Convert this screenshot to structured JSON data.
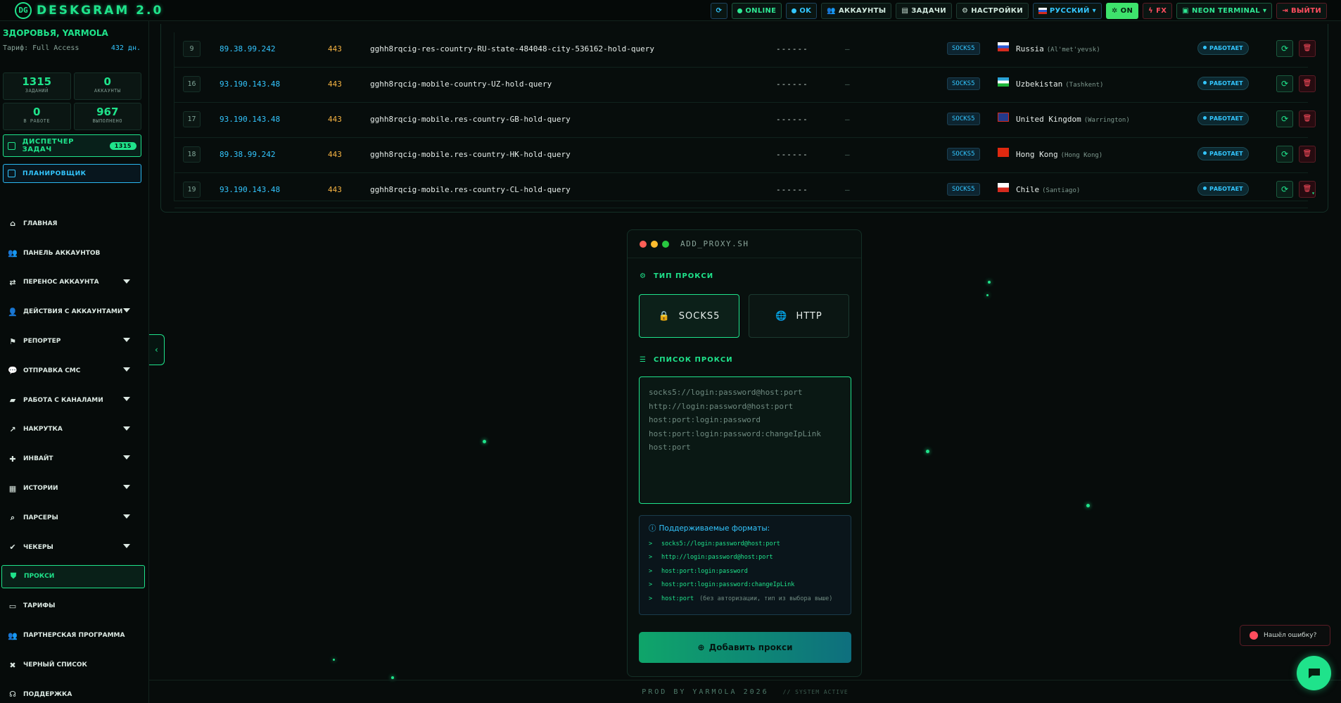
{
  "brand": {
    "name": "DESKGRAM 2.0",
    "logo_text": "DG"
  },
  "topbar": {
    "refresh_icon": "refresh-icon",
    "online": "ONLINE",
    "ok": "OK",
    "accounts": "АККАУНТЫ",
    "tasks": "ЗАДАЧИ",
    "settings": "НАСТРОЙКИ",
    "language": "РУССКИЙ",
    "on": "ON",
    "fx": "FX",
    "theme": "NEON TERMINAL",
    "logout": "ВЫЙТИ"
  },
  "sidebar": {
    "greeting": "ЗДОРОВЬЯ, YARMOLA",
    "plan_label": "Тариф: Full Access",
    "plan_days": "432 дн.",
    "stats": [
      {
        "value": "1315",
        "label": "ЗАДАНИЙ"
      },
      {
        "value": "0",
        "label": "АККАУНТЫ"
      },
      {
        "value": "0",
        "label": "В РАБОТЕ"
      },
      {
        "value": "967",
        "label": "ВЫПОЛНЕНО"
      }
    ],
    "task_dispatcher": "ДИСПЕТЧЕР ЗАДАЧ",
    "task_dispatcher_count": "1315",
    "scheduler": "ПЛАНИРОВЩИК",
    "menu": [
      "ГЛАВНАЯ",
      "ПАНЕЛЬ АККАУНТОВ",
      "ПЕРЕНОС АККАУНТА",
      "ДЕЙСТВИЯ С АККАУНТАМИ",
      "РЕПОРТЕР",
      "ОТПРАВКА СМС",
      "РАБОТА С КАНАЛАМИ",
      "НАКРУТКА",
      "ИНВАЙТ",
      "ИСТОРИИ",
      "ПАРСЕРЫ",
      "ЧЕКЕРЫ",
      "ПРОКСИ",
      "ТАРИФЫ",
      "ПАРТНЕРСКАЯ ПРОГРАММА",
      "ЧЕРНЫЙ СПИСОК",
      "ПОДДЕРЖКА"
    ]
  },
  "proxies": [
    {
      "id": "9",
      "ip": "89.38.99.242",
      "port": "443",
      "user": "gghh8rqcig-res-country-RU-state-484048-city-536162-hold-query",
      "password": "------",
      "extra": "—",
      "type": "SOCKS5",
      "country": "Russia",
      "city": "(Al'met'yevsk)",
      "status": "РАБОТАЕТ"
    },
    {
      "id": "16",
      "ip": "93.190.143.48",
      "port": "443",
      "user": "gghh8rqcig-mobile-country-UZ-hold-query",
      "password": "------",
      "extra": "—",
      "type": "SOCKS5",
      "country": "Uzbekistan",
      "city": "(Tashkent)",
      "status": "РАБОТАЕТ"
    },
    {
      "id": "17",
      "ip": "93.190.143.48",
      "port": "443",
      "user": "gghh8rqcig-mobile.res-country-GB-hold-query",
      "password": "------",
      "extra": "—",
      "type": "SOCKS5",
      "country": "United Kingdom",
      "city": "(Warrington)",
      "status": "РАБОТАЕТ"
    },
    {
      "id": "18",
      "ip": "89.38.99.242",
      "port": "443",
      "user": "gghh8rqcig-mobile.res-country-HK-hold-query",
      "password": "------",
      "extra": "—",
      "type": "SOCKS5",
      "country": "Hong Kong",
      "city": "(Hong Kong)",
      "status": "РАБОТАЕТ"
    },
    {
      "id": "19",
      "ip": "93.190.143.48",
      "port": "443",
      "user": "gghh8rqcig-mobile.res-country-CL-hold-query",
      "password": "------",
      "extra": "—",
      "type": "SOCKS5",
      "country": "Chile",
      "city": "(Santiago)",
      "status": "РАБОТАЕТ"
    }
  ],
  "dialog": {
    "title": "ADD_PROXY.SH",
    "type_label": "ТИП ПРОКСИ",
    "socks5": "SOCKS5",
    "http": "HTTP",
    "list_label": "СПИСОК ПРОКСИ",
    "placeholder": "socks5://login:password@host:port\nhttp://login:password@host:port\nhost:port:login:password\nhost:port:login:password:changeIpLink\nhost:port",
    "formats_title": "Поддерживаемые форматы:",
    "formats": [
      {
        "code": "socks5://login:password@host:port",
        "note": ""
      },
      {
        "code": "http://login:password@host:port",
        "note": ""
      },
      {
        "code": "host:port:login:password",
        "note": ""
      },
      {
        "code": "host:port:login:password:changeIpLink",
        "note": ""
      },
      {
        "code": "host:port",
        "note": "(без авторизации, тип из выбора выше)"
      }
    ],
    "add_button": "Добавить прокси"
  },
  "footer": {
    "credit": "PROD BY YARMOLA 2026",
    "status": "// SYSTEM ACTIVE"
  },
  "bug_button": "Нашёл ошибку?",
  "colors": {
    "accent": "#1fe38b",
    "cyan": "#33c6ff",
    "danger": "#ff4d5e",
    "port": "#f5b342"
  }
}
